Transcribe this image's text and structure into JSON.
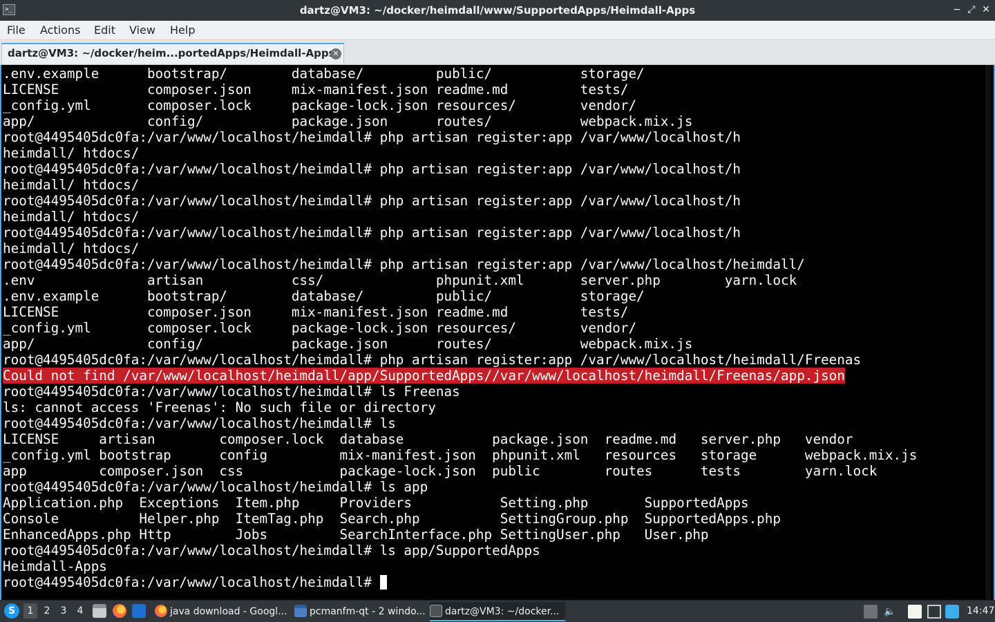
{
  "window": {
    "title": "dartz@VM3: ~/docker/heimdall/www/SupportedApps/Heimdall-Apps",
    "app_icon_glyph": ">_",
    "controls": {
      "minimize": "−",
      "maximize": "⤢",
      "close": "✕"
    }
  },
  "menu": {
    "items": [
      "File",
      "Actions",
      "Edit",
      "View",
      "Help"
    ]
  },
  "tab": {
    "label": "dartz@VM3: ~/docker/heim...portedApps/Heimdall-Apps",
    "close_glyph": "✕"
  },
  "terminal": {
    "lines": [
      ".env.example      bootstrap/        database/         public/           storage/",
      "LICENSE           composer.json     mix-manifest.json readme.md         tests/",
      "_config.yml       composer.lock     package-lock.json resources/        vendor/",
      "app/              config/           package.json      routes/           webpack.mix.js",
      "root@4495405dc0fa:/var/www/localhost/heimdall# php artisan register:app /var/www/localhost/h",
      "heimdall/ htdocs/",
      "root@4495405dc0fa:/var/www/localhost/heimdall# php artisan register:app /var/www/localhost/h",
      "heimdall/ htdocs/",
      "root@4495405dc0fa:/var/www/localhost/heimdall# php artisan register:app /var/www/localhost/h",
      "heimdall/ htdocs/",
      "root@4495405dc0fa:/var/www/localhost/heimdall# php artisan register:app /var/www/localhost/h",
      "heimdall/ htdocs/",
      "root@4495405dc0fa:/var/www/localhost/heimdall# php artisan register:app /var/www/localhost/heimdall/",
      ".env              artisan           css/              phpunit.xml       server.php        yarn.lock",
      ".env.example      bootstrap/        database/         public/           storage/",
      "LICENSE           composer.json     mix-manifest.json readme.md         tests/",
      "_config.yml       composer.lock     package-lock.json resources/        vendor/",
      "app/              config/           package.json      routes/           webpack.mix.js",
      "root@4495405dc0fa:/var/www/localhost/heimdall# php artisan register:app /var/www/localhost/heimdall/Freenas",
      "Could not find /var/www/localhost/heimdall/app/SupportedApps//var/www/localhost/heimdall/Freenas/app.json",
      "root@4495405dc0fa:/var/www/localhost/heimdall# ls Freenas",
      "ls: cannot access 'Freenas': No such file or directory",
      "root@4495405dc0fa:/var/www/localhost/heimdall# ls",
      "LICENSE     artisan        composer.lock  database           package.json  readme.md   server.php   vendor",
      "_config.yml bootstrap      config         mix-manifest.json  phpunit.xml   resources   storage      webpack.mix.js",
      "app         composer.json  css            package-lock.json  public        routes      tests        yarn.lock",
      "root@4495405dc0fa:/var/www/localhost/heimdall# ls app",
      "Application.php  Exceptions  Item.php     Providers           Setting.php       SupportedApps",
      "Console          Helper.php  ItemTag.php  Search.php          SettingGroup.php  SupportedApps.php",
      "EnhancedApps.php Http        Jobs         SearchInterface.php SettingUser.php   User.php",
      "root@4495405dc0fa:/var/www/localhost/heimdall# ls app/SupportedApps",
      "Heimdall-Apps",
      "root@4495405dc0fa:/var/www/localhost/heimdall# "
    ],
    "error_line_index": 19,
    "colors": {
      "background": "#000000",
      "foreground": "#fcfcfc",
      "error_bg": "#c41f26",
      "accent": "#3daee9"
    }
  },
  "taskbar": {
    "start_glyph": "S",
    "workspaces": [
      "1",
      "2",
      "3",
      "4"
    ],
    "active_workspace": "1",
    "launchers": [
      "file-manager-icon",
      "firefox-icon",
      "desktop-icon"
    ],
    "tasks": [
      {
        "label": "java download - Googl...",
        "icon": "firefox-icon"
      },
      {
        "label": "pcmanfm-qt - 2 windo...",
        "icon": "folder-icon"
      },
      {
        "label": "dartz@VM3: ~/docker...",
        "icon": "terminal-icon"
      }
    ],
    "tray": [
      "notification-icon",
      "volume-icon",
      "clipboard-icon",
      "network-icon",
      "update-icon"
    ],
    "clock": "14:47"
  }
}
